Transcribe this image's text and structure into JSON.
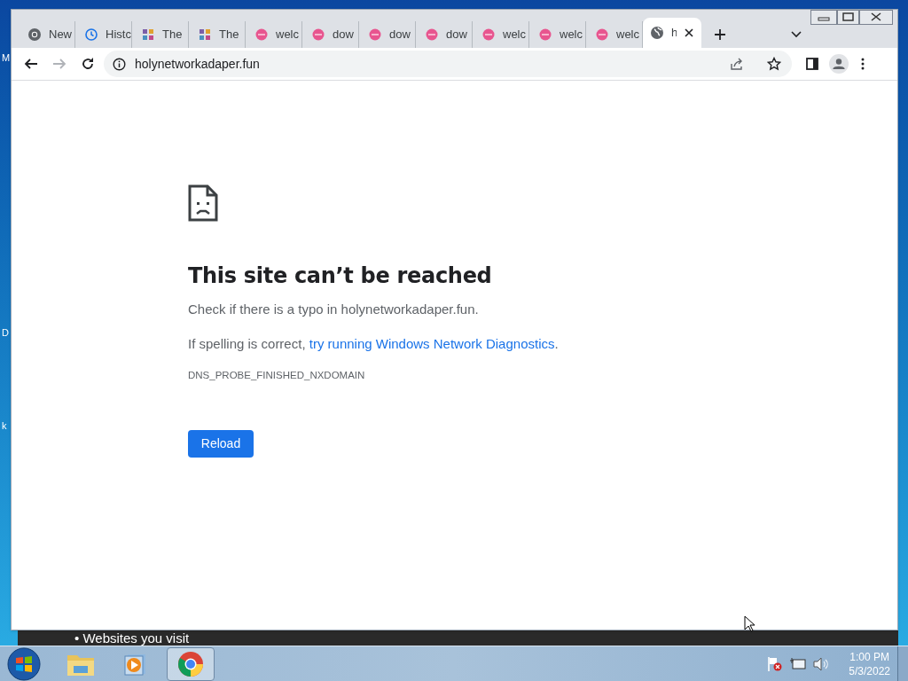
{
  "desktop": {
    "edge_labels": [
      "M",
      "D",
      "k"
    ]
  },
  "background_window": {
    "bullet_text": "• Websites you visit"
  },
  "browser": {
    "tabs": [
      {
        "label": "New",
        "kind": "chrome",
        "selected": false
      },
      {
        "label": "Histc",
        "kind": "history",
        "selected": false
      },
      {
        "label": "The",
        "kind": "puzzle",
        "selected": false
      },
      {
        "label": "The",
        "kind": "puzzle",
        "selected": false
      },
      {
        "label": "welc",
        "kind": "pink",
        "selected": false
      },
      {
        "label": "dow",
        "kind": "pink",
        "selected": false
      },
      {
        "label": "dow",
        "kind": "pink",
        "selected": false
      },
      {
        "label": "dow",
        "kind": "pink",
        "selected": false
      },
      {
        "label": "welc",
        "kind": "pink",
        "selected": false
      },
      {
        "label": "welc",
        "kind": "pink",
        "selected": false
      },
      {
        "label": "welc",
        "kind": "pink",
        "selected": false
      },
      {
        "label": "h",
        "kind": "globe",
        "selected": true
      }
    ],
    "address": "holynetworkadaper.fun"
  },
  "page": {
    "title": "This site can’t be reached",
    "hint": "Check if there is a typo in holynetworkadaper.fun.",
    "suggestion": {
      "before": "If spelling is correct, ",
      "link": "try running Windows Network Diagnostics",
      "after": "."
    },
    "error_code": "DNS_PROBE_FINISHED_NXDOMAIN",
    "button": "Reload"
  },
  "taskbar": {
    "apps": [
      {
        "kind": "explorer",
        "active": false
      },
      {
        "kind": "media",
        "active": false
      },
      {
        "kind": "chrome",
        "active": true
      }
    ],
    "clock": {
      "time": "1:00 PM",
      "date": "5/3/2022"
    }
  }
}
